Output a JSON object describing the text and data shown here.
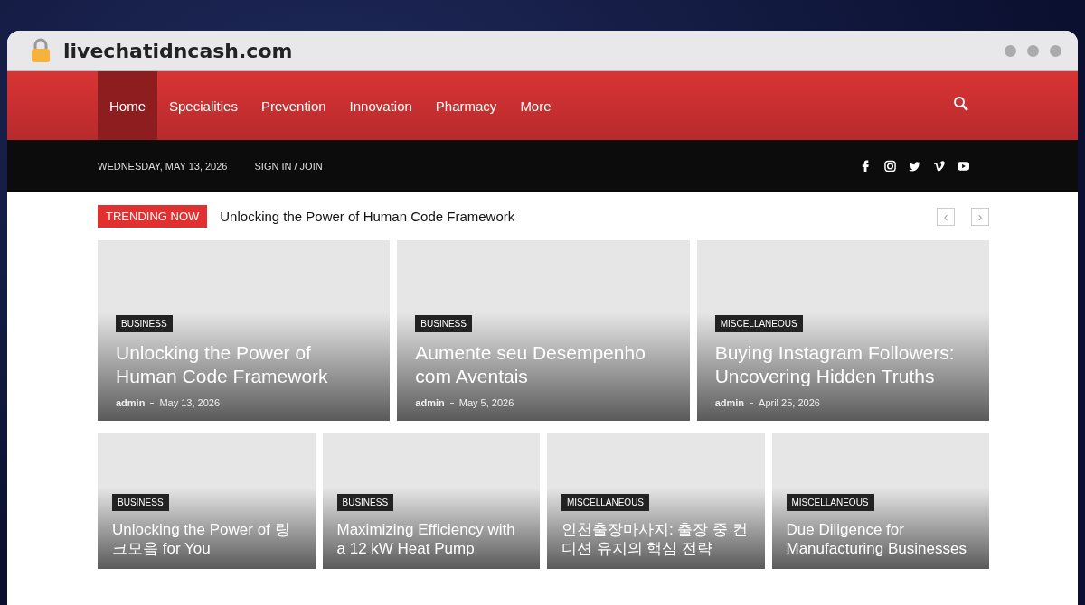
{
  "browser": {
    "url": "livechatidncash.com"
  },
  "nav": {
    "items": [
      {
        "label": "Home",
        "selected": true
      },
      {
        "label": "Specialities",
        "selected": false
      },
      {
        "label": "Prevention",
        "selected": false
      },
      {
        "label": "Innovation",
        "selected": false
      },
      {
        "label": "Pharmacy",
        "selected": false
      },
      {
        "label": "More",
        "selected": false
      }
    ]
  },
  "topbar": {
    "date": "WEDNESDAY, MAY 13, 2026",
    "signin": "SIGN IN / JOIN",
    "social": [
      {
        "kind": "facebook"
      },
      {
        "kind": "instagram"
      },
      {
        "kind": "twitter"
      },
      {
        "kind": "vimeo"
      },
      {
        "kind": "youtube"
      }
    ]
  },
  "trending": {
    "label": "TRENDING NOW",
    "headline": "Unlocking the Power of Human Code Framework",
    "prev": "‹",
    "next": "›"
  },
  "featured": [
    {
      "category": "BUSINESS",
      "title": "Unlocking the Power of Human Code Framework",
      "author": "admin",
      "date": "May 13, 2026"
    },
    {
      "category": "BUSINESS",
      "title": "Aumente seu Desempenho com Aventais",
      "author": "admin",
      "date": "May 5, 2026"
    },
    {
      "category": "MISCELLANEOUS",
      "title": "Buying Instagram Followers: Uncovering Hidden Truths",
      "author": "admin",
      "date": "April 25, 2026"
    }
  ],
  "posts": [
    {
      "category": "BUSINESS",
      "title": "Unlocking the Power of 링크모음 for You"
    },
    {
      "category": "BUSINESS",
      "title": "Maximizing Efficiency with a 12 kW Heat Pump"
    },
    {
      "category": "MISCELLANEOUS",
      "title": "인천출장마사지: 출장 중 컨디션 유지의 핵심 전략"
    },
    {
      "category": "MISCELLANEOUS",
      "title": "Due Diligence for Manufacturing Businesses"
    }
  ]
}
